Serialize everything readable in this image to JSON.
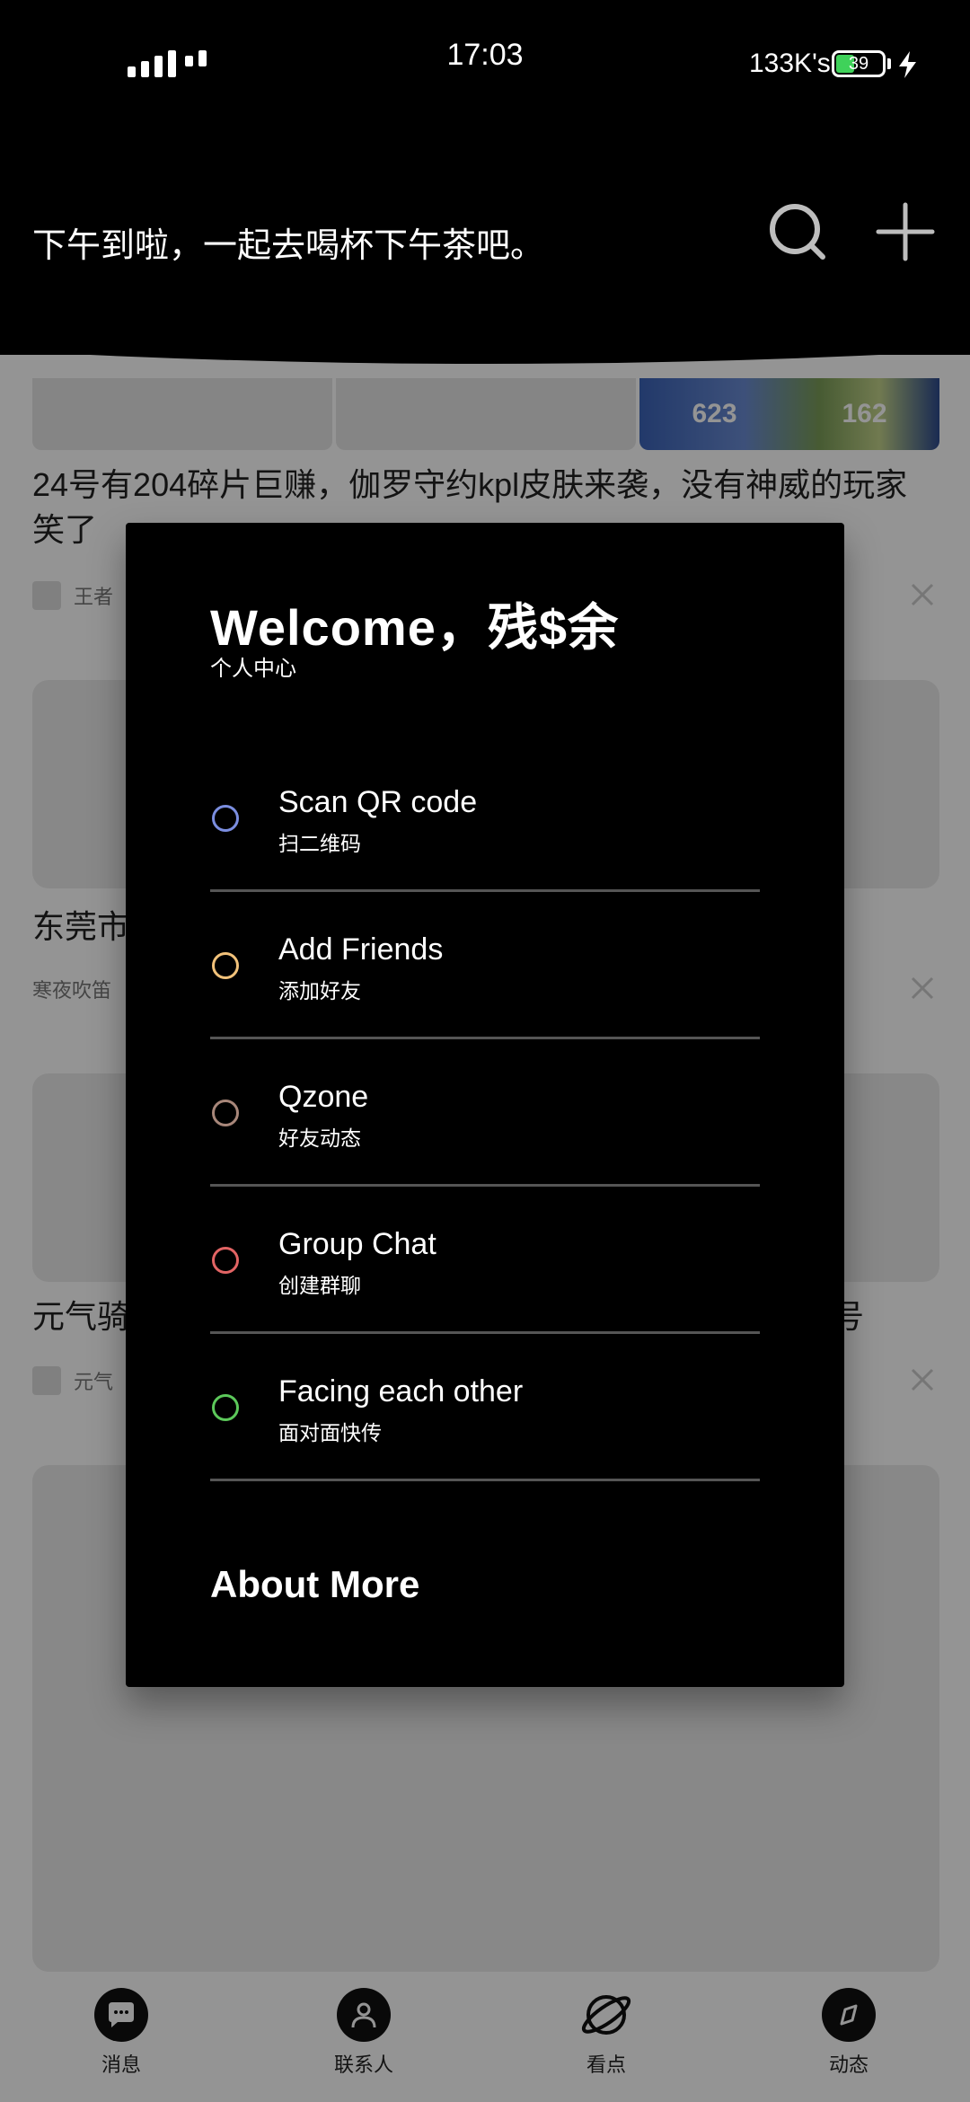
{
  "status_bar": {
    "time": "17:03",
    "network_speed": "133K's",
    "battery_level": "39",
    "battery_color": "#3fd25a"
  },
  "header": {
    "greeting": "下午到啦，一起去喝杯下午茶吧。",
    "search_icon": "search-icon",
    "add_icon": "plus-icon"
  },
  "feed": {
    "banner_numbers": [
      "623",
      "162"
    ],
    "items": [
      {
        "title": "24号有204碎片巨赚，伽罗守约kpl皮肤来袭，没有神威的玩家笑了",
        "source": "王者"
      },
      {
        "title": "东莞市",
        "source": "寒夜吹笛"
      },
      {
        "title": "元气骑",
        "title_tail": "号",
        "source": "元气"
      }
    ]
  },
  "dialog": {
    "welcome": "Welcome，残$余",
    "subtitle": "个人中心",
    "items": [
      {
        "label": "Scan QR code",
        "sub": "扫二维码",
        "color": "#7b8ee0"
      },
      {
        "label": "Add Friends",
        "sub": "添加好友",
        "color": "#f2c27a"
      },
      {
        "label": "Qzone",
        "sub": "好友动态",
        "color": "#a8877a"
      },
      {
        "label": "Group Chat",
        "sub": "创建群聊",
        "color": "#e26464"
      },
      {
        "label": "Facing each other",
        "sub": "面对面快传",
        "color": "#5cc85a"
      }
    ],
    "about": "About More"
  },
  "tabbar": {
    "items": [
      {
        "label": "消息",
        "icon": "chat-icon"
      },
      {
        "label": "联系人",
        "icon": "contact-icon"
      },
      {
        "label": "看点",
        "icon": "planet-icon"
      },
      {
        "label": "动态",
        "icon": "compass-icon"
      }
    ]
  }
}
